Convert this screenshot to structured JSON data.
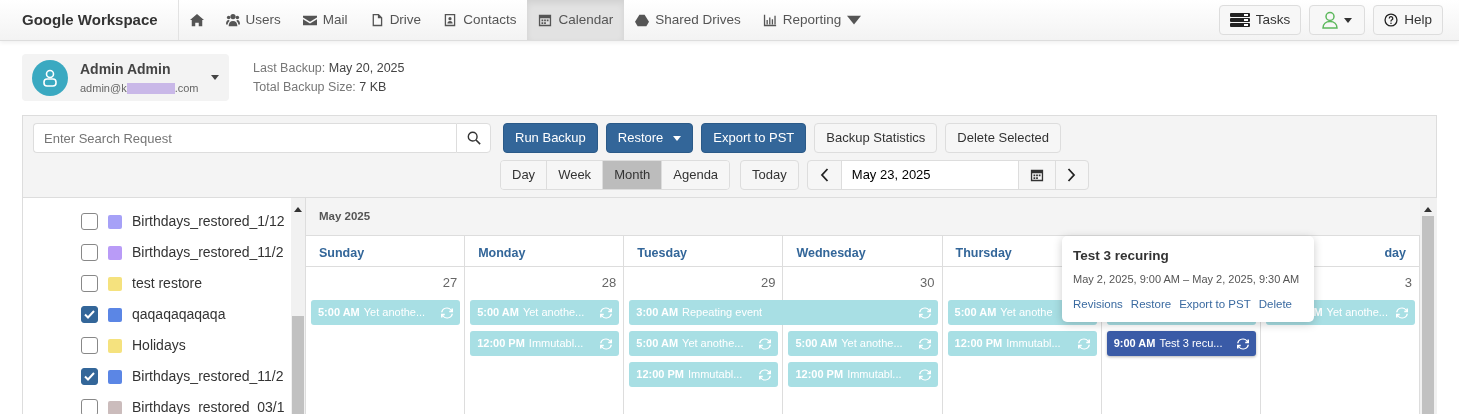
{
  "navbar": {
    "brand": "Google Workspace",
    "items": [
      {
        "kind": "home",
        "selected": false
      },
      {
        "kind": "users",
        "label": "Users",
        "selected": false
      },
      {
        "kind": "mail",
        "label": "Mail",
        "selected": false
      },
      {
        "kind": "drive",
        "label": "Drive",
        "selected": false
      },
      {
        "kind": "contacts",
        "label": "Contacts",
        "selected": false
      },
      {
        "kind": "calendar",
        "label": "Calendar",
        "selected": true
      },
      {
        "kind": "shared",
        "label": "Shared Drives",
        "selected": false
      },
      {
        "kind": "reporting",
        "label": "Reporting",
        "selected": false
      }
    ],
    "right": [
      {
        "kind": "tasks",
        "label": "Tasks"
      },
      {
        "kind": "user_menu"
      },
      {
        "kind": "help",
        "label": "Help"
      }
    ]
  },
  "account": {
    "name": "Admin Admin",
    "email_start": "admin@k",
    "email_end": ".com"
  },
  "backup_info": [
    {
      "label": "Last Backup:",
      "value": "May 20, 2025"
    },
    {
      "label": "Total Backup Size:",
      "value": "7 KB"
    }
  ],
  "search": {
    "placeholder": "Enter Search Request"
  },
  "actions": [
    {
      "label": "Run Backup",
      "kind": "primary"
    },
    {
      "label": "Restore",
      "kind": "primary_dropdown"
    },
    {
      "label": "Export to PST",
      "kind": "primary"
    },
    {
      "label": "Backup Statistics",
      "kind": "secondary"
    },
    {
      "label": "Delete Selected",
      "kind": "secondary"
    }
  ],
  "views": [
    {
      "label": "Day",
      "selected": false
    },
    {
      "label": "Week",
      "selected": false
    },
    {
      "label": "Month",
      "selected": true
    },
    {
      "label": "Agenda",
      "selected": false
    }
  ],
  "today_button": "Today",
  "date_field": "May 23, 2025",
  "calendars": [
    {
      "name": "Birthdays_restored_1/12",
      "checked": false,
      "color": "#a6a1f7"
    },
    {
      "name": "Birthdays_restored_11/2",
      "checked": false,
      "color": "#b99bf7"
    },
    {
      "name": "test restore",
      "checked": false,
      "color": "#f5e27e"
    },
    {
      "name": "qaqaqaqaqaqa",
      "checked": true,
      "color": "#5b86e5"
    },
    {
      "name": "Holidays",
      "checked": false,
      "color": "#f5e27e"
    },
    {
      "name": "Birthdays_restored_11/2",
      "checked": true,
      "color": "#5b86e5"
    },
    {
      "name": "Birthdays_restored_03/1",
      "checked": false,
      "color": "#cbbcbc"
    }
  ],
  "calendar": {
    "title": "May 2025",
    "days": [
      {
        "header": "Sunday",
        "number": "27",
        "events": [
          {
            "kind": "single",
            "time": "5:00 AM",
            "title": "Yet anothe...",
            "recurring": true,
            "selected": false
          }
        ]
      },
      {
        "header": "Monday",
        "number": "28",
        "events": [
          {
            "kind": "single",
            "time": "5:00 AM",
            "title": "Yet anothe...",
            "recurring": true,
            "selected": false
          },
          {
            "kind": "single",
            "time": "12:00 PM",
            "title": "Immutabl...",
            "recurring": true,
            "selected": false
          }
        ]
      },
      {
        "header": "Tuesday",
        "number": "29",
        "events": [
          {
            "kind": "two_day",
            "time": "3:00 AM",
            "title": "Repeating event",
            "recurring": true,
            "selected": false
          },
          {
            "kind": "single",
            "time": "5:00 AM",
            "title": "Yet anothe...",
            "recurring": true,
            "selected": false
          },
          {
            "kind": "single",
            "time": "12:00 PM",
            "title": "Immutabl...",
            "recurring": true,
            "selected": false
          }
        ]
      },
      {
        "header": "Wednesday",
        "number": "30",
        "events": [
          {
            "kind": "single",
            "time": "5:00 AM",
            "title": "Yet anothe...",
            "recurring": true,
            "selected": false
          },
          {
            "kind": "single",
            "time": "12:00 PM",
            "title": "Immutabl...",
            "recurring": true,
            "selected": false
          }
        ]
      },
      {
        "header": "Thursday",
        "events": [
          {
            "kind": "single",
            "time": "5:00 AM",
            "title": "Yet anothe",
            "recurring": false,
            "selected": false
          },
          {
            "kind": "single",
            "time": "12:00 PM",
            "title": "Immutabl...",
            "recurring": true,
            "selected": false
          }
        ]
      },
      {
        "events": [
          {
            "kind": "covered"
          },
          {
            "kind": "single",
            "time": "9:00 AM",
            "title": "Test 3 recu...",
            "recurring": true,
            "selected": true
          }
        ]
      },
      {
        "header": "day",
        "number": "3",
        "events": [
          {
            "kind": "partly_covered",
            "time": "M",
            "title": "Yet anothe...",
            "recurring": true,
            "selected": false
          }
        ]
      }
    ]
  },
  "popover": {
    "title": "Test 3 recuring",
    "time": "May 2, 2025, 9:00 AM  – May 2, 2025, 9:30 AM",
    "links": [
      "Revisions",
      "Restore",
      "Export to PST",
      "Delete"
    ]
  }
}
